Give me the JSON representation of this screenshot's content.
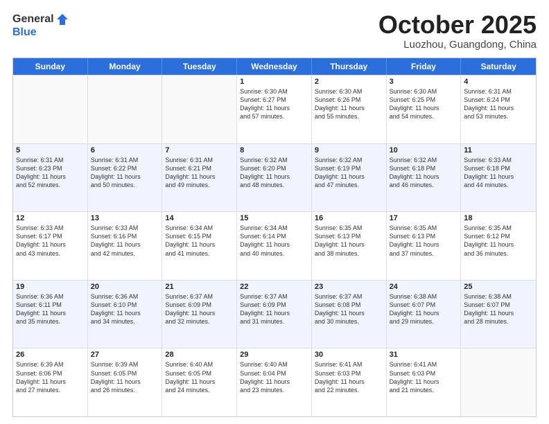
{
  "header": {
    "logo": {
      "general": "General",
      "blue": "Blue"
    },
    "title": "October 2025",
    "location": "Luozhou, Guangdong, China"
  },
  "weekdays": [
    "Sunday",
    "Monday",
    "Tuesday",
    "Wednesday",
    "Thursday",
    "Friday",
    "Saturday"
  ],
  "rows": [
    {
      "alt": false,
      "cells": [
        {
          "day": "",
          "lines": []
        },
        {
          "day": "",
          "lines": []
        },
        {
          "day": "",
          "lines": []
        },
        {
          "day": "1",
          "lines": [
            "Sunrise: 6:30 AM",
            "Sunset: 6:27 PM",
            "Daylight: 11 hours",
            "and 57 minutes."
          ]
        },
        {
          "day": "2",
          "lines": [
            "Sunrise: 6:30 AM",
            "Sunset: 6:26 PM",
            "Daylight: 11 hours",
            "and 55 minutes."
          ]
        },
        {
          "day": "3",
          "lines": [
            "Sunrise: 6:30 AM",
            "Sunset: 6:25 PM",
            "Daylight: 11 hours",
            "and 54 minutes."
          ]
        },
        {
          "day": "4",
          "lines": [
            "Sunrise: 6:31 AM",
            "Sunset: 6:24 PM",
            "Daylight: 11 hours",
            "and 53 minutes."
          ]
        }
      ]
    },
    {
      "alt": true,
      "cells": [
        {
          "day": "5",
          "lines": [
            "Sunrise: 6:31 AM",
            "Sunset: 6:23 PM",
            "Daylight: 11 hours",
            "and 52 minutes."
          ]
        },
        {
          "day": "6",
          "lines": [
            "Sunrise: 6:31 AM",
            "Sunset: 6:22 PM",
            "Daylight: 11 hours",
            "and 50 minutes."
          ]
        },
        {
          "day": "7",
          "lines": [
            "Sunrise: 6:31 AM",
            "Sunset: 6:21 PM",
            "Daylight: 11 hours",
            "and 49 minutes."
          ]
        },
        {
          "day": "8",
          "lines": [
            "Sunrise: 6:32 AM",
            "Sunset: 6:20 PM",
            "Daylight: 11 hours",
            "and 48 minutes."
          ]
        },
        {
          "day": "9",
          "lines": [
            "Sunrise: 6:32 AM",
            "Sunset: 6:19 PM",
            "Daylight: 11 hours",
            "and 47 minutes."
          ]
        },
        {
          "day": "10",
          "lines": [
            "Sunrise: 6:32 AM",
            "Sunset: 6:18 PM",
            "Daylight: 11 hours",
            "and 46 minutes."
          ]
        },
        {
          "day": "11",
          "lines": [
            "Sunrise: 6:33 AM",
            "Sunset: 6:18 PM",
            "Daylight: 11 hours",
            "and 44 minutes."
          ]
        }
      ]
    },
    {
      "alt": false,
      "cells": [
        {
          "day": "12",
          "lines": [
            "Sunrise: 6:33 AM",
            "Sunset: 6:17 PM",
            "Daylight: 11 hours",
            "and 43 minutes."
          ]
        },
        {
          "day": "13",
          "lines": [
            "Sunrise: 6:33 AM",
            "Sunset: 6:16 PM",
            "Daylight: 11 hours",
            "and 42 minutes."
          ]
        },
        {
          "day": "14",
          "lines": [
            "Sunrise: 6:34 AM",
            "Sunset: 6:15 PM",
            "Daylight: 11 hours",
            "and 41 minutes."
          ]
        },
        {
          "day": "15",
          "lines": [
            "Sunrise: 6:34 AM",
            "Sunset: 6:14 PM",
            "Daylight: 11 hours",
            "and 40 minutes."
          ]
        },
        {
          "day": "16",
          "lines": [
            "Sunrise: 6:35 AM",
            "Sunset: 6:13 PM",
            "Daylight: 11 hours",
            "and 38 minutes."
          ]
        },
        {
          "day": "17",
          "lines": [
            "Sunrise: 6:35 AM",
            "Sunset: 6:13 PM",
            "Daylight: 11 hours",
            "and 37 minutes."
          ]
        },
        {
          "day": "18",
          "lines": [
            "Sunrise: 6:35 AM",
            "Sunset: 6:12 PM",
            "Daylight: 11 hours",
            "and 36 minutes."
          ]
        }
      ]
    },
    {
      "alt": true,
      "cells": [
        {
          "day": "19",
          "lines": [
            "Sunrise: 6:36 AM",
            "Sunset: 6:11 PM",
            "Daylight: 11 hours",
            "and 35 minutes."
          ]
        },
        {
          "day": "20",
          "lines": [
            "Sunrise: 6:36 AM",
            "Sunset: 6:10 PM",
            "Daylight: 11 hours",
            "and 34 minutes."
          ]
        },
        {
          "day": "21",
          "lines": [
            "Sunrise: 6:37 AM",
            "Sunset: 6:09 PM",
            "Daylight: 11 hours",
            "and 32 minutes."
          ]
        },
        {
          "day": "22",
          "lines": [
            "Sunrise: 6:37 AM",
            "Sunset: 6:09 PM",
            "Daylight: 11 hours",
            "and 31 minutes."
          ]
        },
        {
          "day": "23",
          "lines": [
            "Sunrise: 6:37 AM",
            "Sunset: 6:08 PM",
            "Daylight: 11 hours",
            "and 30 minutes."
          ]
        },
        {
          "day": "24",
          "lines": [
            "Sunrise: 6:38 AM",
            "Sunset: 6:07 PM",
            "Daylight: 11 hours",
            "and 29 minutes."
          ]
        },
        {
          "day": "25",
          "lines": [
            "Sunrise: 6:38 AM",
            "Sunset: 6:07 PM",
            "Daylight: 11 hours",
            "and 28 minutes."
          ]
        }
      ]
    },
    {
      "alt": false,
      "cells": [
        {
          "day": "26",
          "lines": [
            "Sunrise: 6:39 AM",
            "Sunset: 6:06 PM",
            "Daylight: 11 hours",
            "and 27 minutes."
          ]
        },
        {
          "day": "27",
          "lines": [
            "Sunrise: 6:39 AM",
            "Sunset: 6:05 PM",
            "Daylight: 11 hours",
            "and 26 minutes."
          ]
        },
        {
          "day": "28",
          "lines": [
            "Sunrise: 6:40 AM",
            "Sunset: 6:05 PM",
            "Daylight: 11 hours",
            "and 24 minutes."
          ]
        },
        {
          "day": "29",
          "lines": [
            "Sunrise: 6:40 AM",
            "Sunset: 6:04 PM",
            "Daylight: 11 hours",
            "and 23 minutes."
          ]
        },
        {
          "day": "30",
          "lines": [
            "Sunrise: 6:41 AM",
            "Sunset: 6:03 PM",
            "Daylight: 11 hours",
            "and 22 minutes."
          ]
        },
        {
          "day": "31",
          "lines": [
            "Sunrise: 6:41 AM",
            "Sunset: 6:03 PM",
            "Daylight: 11 hours",
            "and 21 minutes."
          ]
        },
        {
          "day": "",
          "lines": []
        }
      ]
    }
  ]
}
